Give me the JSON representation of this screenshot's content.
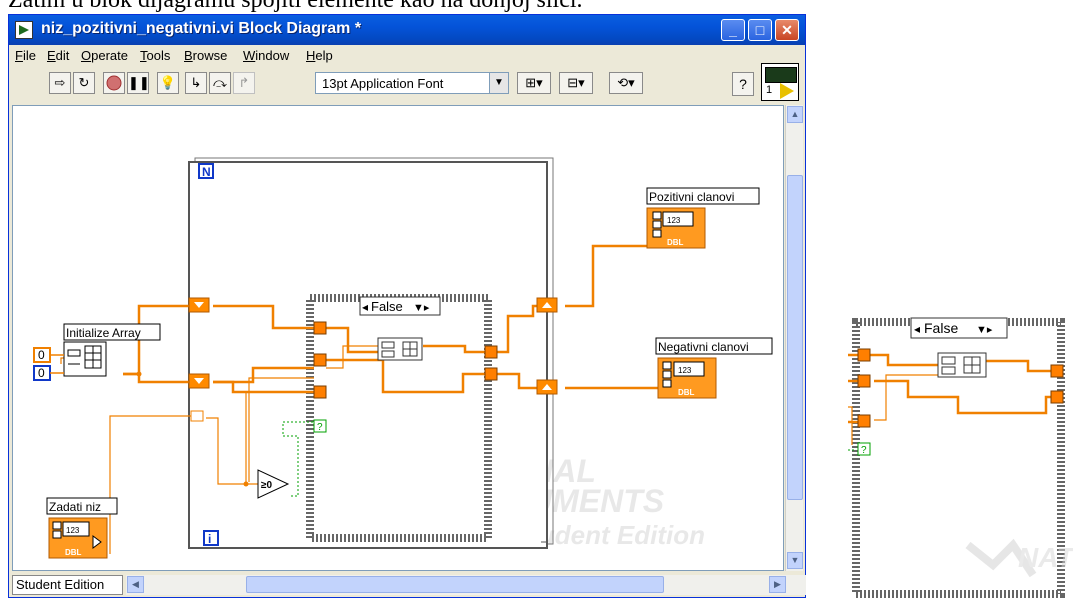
{
  "caption": "Zatim u blok dijagramu spojiti elemente kao na donjoj slici.",
  "window": {
    "title": "niz_pozitivni_negativni.vi Block Diagram *",
    "controls": {
      "minimize": "_",
      "maximize": "□",
      "close": "✕"
    }
  },
  "menu": [
    {
      "ul": "F",
      "rest": "ile"
    },
    {
      "ul": "E",
      "rest": "dit"
    },
    {
      "ul": "O",
      "rest": "perate"
    },
    {
      "ul": "T",
      "rest": "ools"
    },
    {
      "ul": "B",
      "rest": "rowse"
    },
    {
      "ul": "W",
      "rest": "indow"
    },
    {
      "ul": "H",
      "rest": "elp"
    }
  ],
  "toolbar": {
    "font": "13pt Application Font",
    "help": "?",
    "icons": [
      "run-arrow-icon",
      "run-continuously-icon",
      "abort-icon",
      "pause-icon",
      "highlight-execution-icon",
      "retain-wire-values-icon",
      "step-into-icon",
      "step-over-icon",
      "step-out-icon",
      "align-icon",
      "distribute-icon",
      "reorder-icon",
      "help-icon"
    ]
  },
  "vi_icon": {
    "number": "1"
  },
  "diagram": {
    "for_loop": {
      "count_terminal": "N",
      "iteration_terminal": "i"
    },
    "case_selector": "False",
    "nodes": {
      "initialize_array": "Initialize Array",
      "zadati_niz": "Zadati niz",
      "pozitivni": "Pozitivni clanovi",
      "negativni": "Negativni clanovi",
      "const_element": "0",
      "const_size": "0",
      "compare": "≥0",
      "indicator_type": "DBL",
      "indicator_value": "123"
    },
    "watermark": {
      "line1": "NATIONAL",
      "line2": "INSTRUMENTS",
      "line3": "LabVIEW Student Edition"
    }
  },
  "statusbar": {
    "label": "Student Edition"
  },
  "side_panel": {
    "case_selector": "False",
    "watermark": "NATIONAL INSTRUMENTS"
  },
  "colors": {
    "wire_orange": "#f08000",
    "tunnel_orange": "#ff7f00",
    "wire_green": "#00a000",
    "xp_blue": "#0453d8"
  }
}
